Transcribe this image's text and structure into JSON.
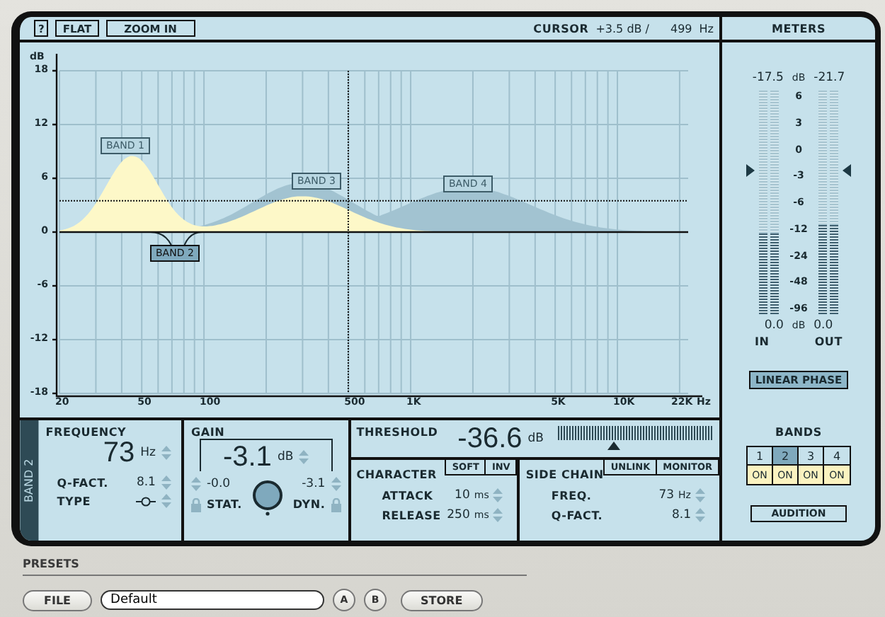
{
  "toolbar": {
    "buttons": [
      {
        "label": "?"
      },
      {
        "label": "FLAT"
      },
      {
        "label": "ZOOM IN"
      }
    ],
    "cursor_label": "CURSOR",
    "cursor_db": "+3.5 dB /",
    "cursor_hz": "499",
    "cursor_unit": "Hz"
  },
  "graph": {
    "y_unit": "dB",
    "y_ticks": [
      "18",
      "12",
      "6",
      "0",
      "-6",
      "-12",
      "-18"
    ],
    "x_ticks": [
      "20",
      "50",
      "100",
      "500",
      "1K",
      "5K",
      "10K",
      "22K"
    ],
    "x_unit": "Hz",
    "bands": [
      {
        "label": "BAND 1",
        "selected": false
      },
      {
        "label": "BAND 2",
        "selected": true
      },
      {
        "label": "BAND 3",
        "selected": false
      },
      {
        "label": "BAND 4",
        "selected": false
      }
    ]
  },
  "meters": {
    "title": "METERS",
    "peak_unit": "dB",
    "value_unit": "dB",
    "scale": [
      "6",
      "3",
      "0",
      "-3",
      "-6",
      "-12",
      "-24",
      "-48",
      "-96"
    ],
    "channels": [
      {
        "label": "IN",
        "peak": "-17.5",
        "value": "0.0",
        "level": 0.36
      },
      {
        "label": "OUT",
        "peak": "-21.7",
        "value": "0.0",
        "level": 0.4
      }
    ],
    "linear_phase": {
      "label": "LINEAR PHASE",
      "on": true
    }
  },
  "band_panel": {
    "tab": "BAND 2",
    "frequency": {
      "title": "FREQUENCY",
      "value": "73",
      "unit": "Hz",
      "q_label": "Q-FACT.",
      "q_value": "8.1",
      "type_label": "TYPE"
    },
    "gain": {
      "title": "GAIN",
      "value": "-3.1",
      "unit": "dB",
      "static_value": "-0.0",
      "dynamic_value": "-3.1",
      "static_label": "STAT.",
      "dynamic_label": "DYN."
    },
    "threshold": {
      "title": "THRESHOLD",
      "value": "-36.6",
      "unit": "dB",
      "level": 0.35
    },
    "character": {
      "title": "CHARACTER",
      "buttons": [
        "SOFT",
        "INV"
      ],
      "attack_label": "ATTACK",
      "attack_value": "10",
      "attack_unit": "ms",
      "release_label": "RELEASE",
      "release_value": "250",
      "release_unit": "ms"
    },
    "side_chain": {
      "title": "SIDE CHAIN",
      "buttons": [
        "UNLINK",
        "MONITOR"
      ],
      "freq_label": "FREQ.",
      "freq_value": "73",
      "freq_unit": "Hz",
      "q_label": "Q-FACT.",
      "q_value": "8.1"
    }
  },
  "bands_panel": {
    "title": "BANDS",
    "bands": [
      {
        "number": "1",
        "selected": false,
        "toggle": "ON",
        "on": true
      },
      {
        "number": "2",
        "selected": true,
        "toggle": "ON",
        "on": true
      },
      {
        "number": "3",
        "selected": false,
        "toggle": "ON",
        "on": true
      },
      {
        "number": "4",
        "selected": false,
        "toggle": "ON",
        "on": true
      }
    ],
    "audition": "AUDITION"
  },
  "presets": {
    "title": "PRESETS",
    "file_button": "FILE",
    "preset_name": "Default",
    "buttons": [
      "A",
      "B"
    ],
    "store_button": "STORE"
  }
}
